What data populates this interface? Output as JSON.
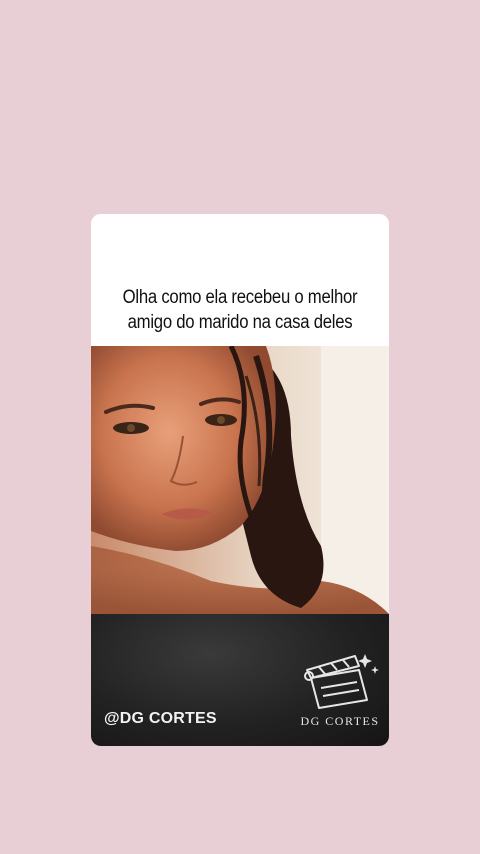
{
  "post": {
    "caption": "Olha como ela recebeu o melhor amigo do marido na casa deles",
    "handle": "@DG CORTES",
    "logo_text": "DG CORTES"
  },
  "colors": {
    "background": "#e8cfd6",
    "card": "#ffffff",
    "footer": "#222222",
    "text_dark": "#111111",
    "text_light": "#f2f2f2"
  },
  "icons": {
    "logo": "clapperboard-icon"
  }
}
